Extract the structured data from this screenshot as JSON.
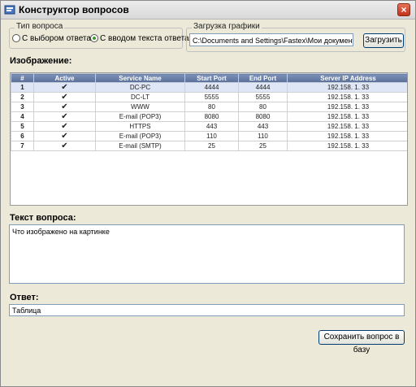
{
  "window": {
    "title": "Конструктор вопросов",
    "close_glyph": "×"
  },
  "question_type": {
    "title": "Тип вопроса",
    "options": [
      {
        "label": "С выбором ответа",
        "selected": false
      },
      {
        "label": "С вводом текста ответа",
        "selected": true
      }
    ]
  },
  "graphics_upload": {
    "title": "Загрузка графики",
    "path": "C:\\Documents and Settings\\Fastex\\Мои документы\\Мои",
    "button_label": "Загрузить"
  },
  "image_label": "Изображение:",
  "table": {
    "columns": [
      "#",
      "Active",
      "Service Name",
      "Start Port",
      "End Port",
      "Server IP Address"
    ],
    "rows": [
      [
        "1",
        "✔",
        "DC-PC",
        "4444",
        "4444",
        "192.158. 1. 33"
      ],
      [
        "2",
        "✔",
        "DC-LT",
        "5555",
        "5555",
        "192.158. 1. 33"
      ],
      [
        "3",
        "✔",
        "WWW",
        "80",
        "80",
        "192.158. 1. 33"
      ],
      [
        "4",
        "✔",
        "E-mail (POP3)",
        "8080",
        "8080",
        "192.158. 1. 33"
      ],
      [
        "5",
        "✔",
        "HTTPS",
        "443",
        "443",
        "192.158. 1. 33"
      ],
      [
        "6",
        "✔",
        "E-mail (POP3)",
        "110",
        "110",
        "192.158. 1. 33"
      ],
      [
        "7",
        "✔",
        "E-mail (SMTP)",
        "25",
        "25",
        "192.158. 1. 33"
      ]
    ]
  },
  "question_text": {
    "label": "Текст вопроса:",
    "value": "Что изображено на картинке"
  },
  "answer": {
    "label": "Ответ:",
    "value": "Таблица"
  },
  "save_button_label": "Сохранить вопрос в базу"
}
